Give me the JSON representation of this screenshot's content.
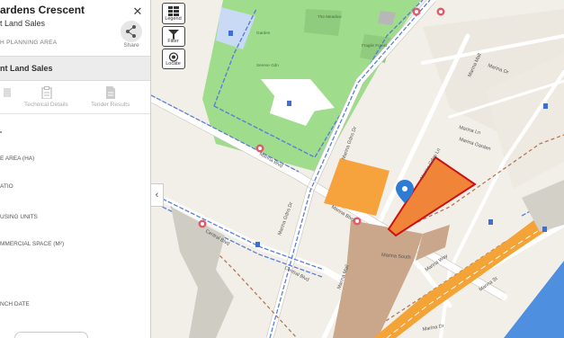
{
  "panel": {
    "title": "ardens Crescent",
    "subtitle": "t Land Sales",
    "area": "H PLANNING AREA",
    "share_label": "Share",
    "section_title": "nt Land Sales",
    "tabs": [
      {
        "label": ""
      },
      {
        "label": "Technical Details"
      },
      {
        "label": "Tender Results"
      }
    ],
    "fields": [
      "E AREA (HA)",
      "ATIO",
      "USING UNITS",
      "MMERCIAL SPACE (M²)",
      "NCH DATE"
    ]
  },
  "controls": {
    "legend": "Legend",
    "filter": "Filter",
    "locate": "Locate"
  },
  "map": {
    "roads": {
      "marina_blvd_upper": "Marina Blvd",
      "marina_blvd_lower": "Marina Blvd",
      "central_blvd_left": "Central Blvd",
      "central_blvd_right": "Central Blvd",
      "marina_gdns_dr_left": "Marina Gdns Dr",
      "marina_gdns_dr_right": "Marina Gdns Dr",
      "marina_mall_top": "Marina Mall",
      "marina_mall_bottom": "Marina Mall",
      "marina_dr_right": "Marina Dr",
      "marina_ln": "Marina Ln",
      "marina_garden": "Marina Garden",
      "marina_south": "Marina South",
      "marina_gdns_ln": "Marina Gdns Ln",
      "marina_way": "Marina Way",
      "marina_st": "Marina St",
      "marina_dr_lower": "Marina Dr"
    },
    "park_labels": {
      "meadow": "The Meadow",
      "forest": "Fragile Forest",
      "serene": "Serene Gdn",
      "garden": "Garden"
    },
    "colors": {
      "park": "#9fdc8c",
      "water": "#4e8fe0",
      "site_highlight": "#f08439",
      "site_border": "#cc1111",
      "parcel_orange": "#f6a23d",
      "highway": "#f4a336"
    }
  }
}
